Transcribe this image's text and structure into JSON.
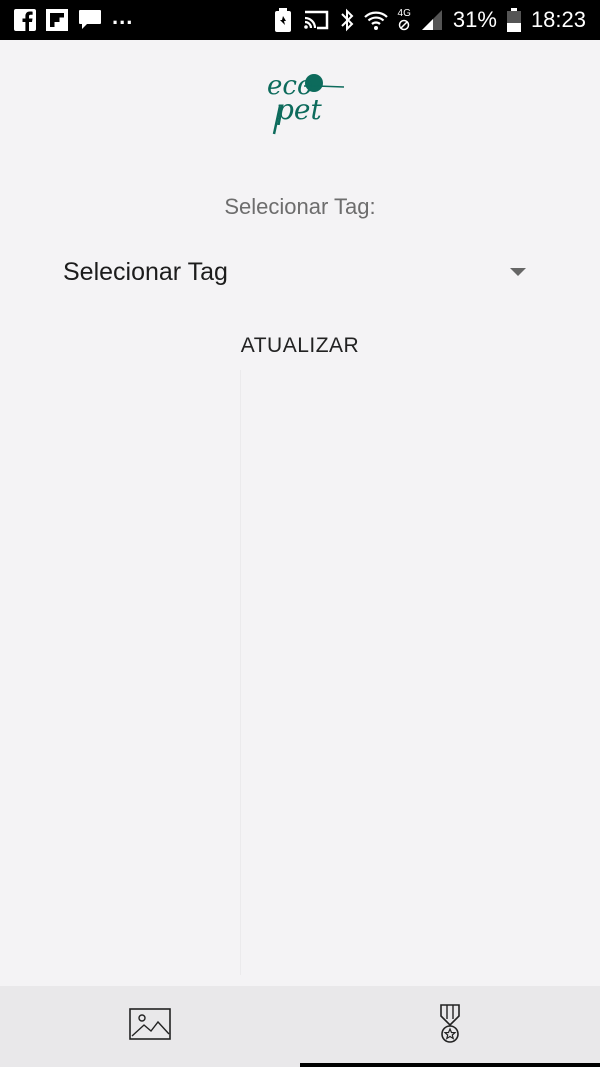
{
  "status_bar": {
    "left_icons": [
      "facebook-icon",
      "flipboard-icon",
      "message-icon"
    ],
    "overflow": "...",
    "right_icons": [
      "recycle-icon",
      "cast-icon",
      "bluetooth-icon",
      "wifi-icon",
      "network-4g-icon",
      "signal-icon"
    ],
    "network_label": "4G",
    "battery": "31%",
    "time": "18:23"
  },
  "header": {
    "logo_text_top": "eco",
    "logo_text_bottom": "pet",
    "brand_color": "#0d6b5c"
  },
  "form": {
    "label": "Selecionar Tag:",
    "dropdown_value": "Selecionar Tag",
    "update_button": "ATUALIZAR"
  },
  "bottom_nav": {
    "tabs": [
      {
        "icon": "image-icon",
        "active": false
      },
      {
        "icon": "medal-icon",
        "active": true
      }
    ]
  }
}
